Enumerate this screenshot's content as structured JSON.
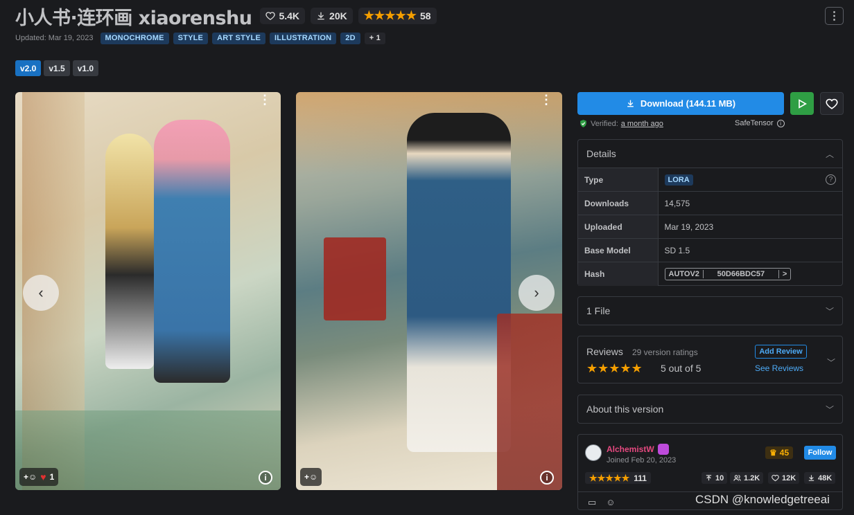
{
  "header": {
    "title": "小人书·连环画 xiaorenshu",
    "likes": "5.4K",
    "downloads": "20K",
    "stars": "★★★★★",
    "rating_count": "58",
    "menu_icon": "dots-vertical-icon"
  },
  "meta": {
    "updated": "Updated: Mar 19, 2023",
    "tags": [
      "MONOCHROME",
      "STYLE",
      "ART STYLE",
      "ILLUSTRATION",
      "2D"
    ],
    "more_tags": "+ 1"
  },
  "versions": [
    "v2.0",
    "v1.5",
    "v1.0"
  ],
  "gallery": {
    "prev_arrow": "‹",
    "next_arrow": "›",
    "card1_reaction_add": "+☺",
    "card1_heart_count": "1",
    "card2_reaction_add": "+☺",
    "info": "i"
  },
  "sidebar": {
    "download_label": "Download (144.11 MB)",
    "verified_prefix": "Verified:",
    "verified_time": "a month ago",
    "safetensor": "SafeTensor",
    "details": {
      "title": "Details",
      "rows": {
        "type_label": "Type",
        "type_value": "LORA",
        "downloads_label": "Downloads",
        "downloads_value": "14,575",
        "uploaded_label": "Uploaded",
        "uploaded_value": "Mar 19, 2023",
        "base_label": "Base Model",
        "base_value": "SD 1.5",
        "hash_label": "Hash",
        "hash_type": "AUTOV2",
        "hash_value": "50D66BDC57",
        "hash_next": ">"
      }
    },
    "files": "1 File",
    "reviews": {
      "label": "Reviews",
      "count": "29 version ratings",
      "stars": "★★★★★",
      "out_of": "5 out of 5",
      "add": "Add Review",
      "see": "See Reviews"
    },
    "about": "About this version",
    "creator": {
      "name": "AlchemistW",
      "joined": "Joined Feb 20, 2023",
      "rank": "45",
      "follow": "Follow",
      "stars": "★★★★★",
      "rating_count": "111",
      "uploads": "10",
      "followers": "1.2K",
      "likes": "12K",
      "downloads": "48K"
    }
  },
  "watermark": "CSDN @knowledgetreeai",
  "colors": {
    "accent": "#228be6",
    "green": "#2f9e44",
    "star": "#f59f00",
    "tag_bg": "#1d3a5c",
    "tag_fg": "#a5d8ff"
  }
}
